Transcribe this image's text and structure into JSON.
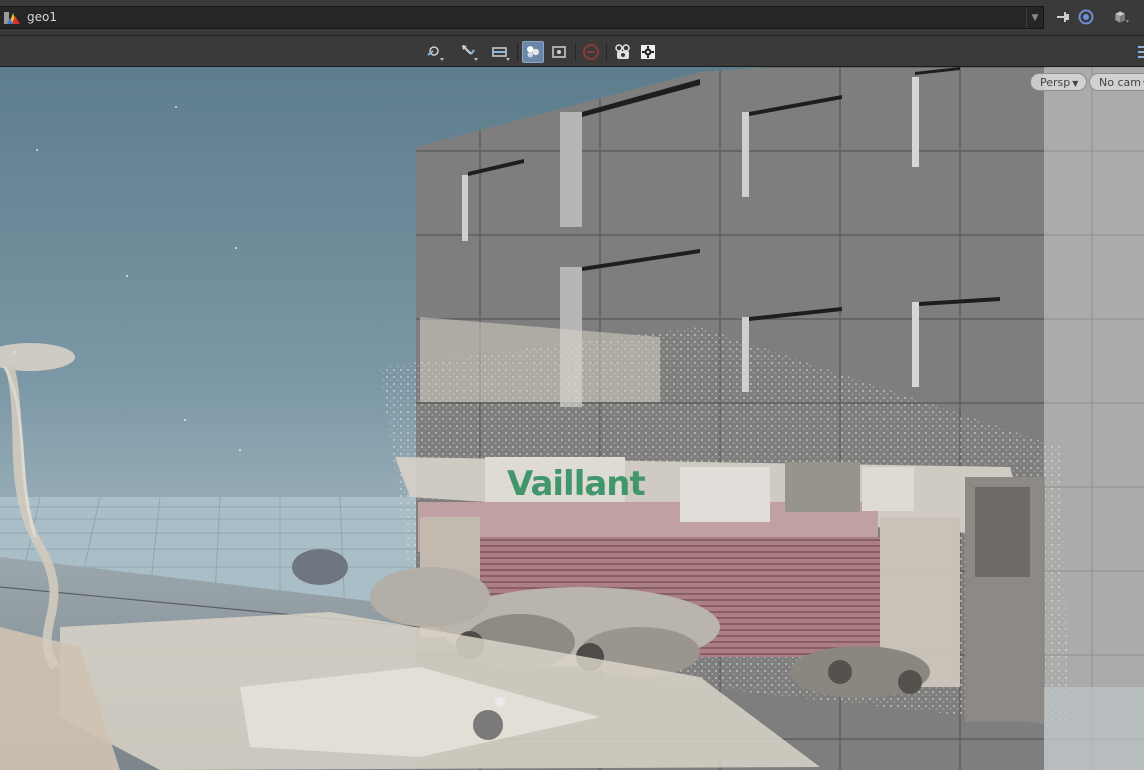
{
  "path_bar": {
    "network_path": "geo1",
    "icons": [
      "houdini-logo-icon",
      "pin-icon",
      "link-target-icon",
      "viewport-cube-icon"
    ]
  },
  "toolbar": {
    "icons": [
      "select-mode-icon",
      "transform-handle-icon",
      "snapping-icon",
      "ghost-objects-icon",
      "display-background-icon",
      "stop-icon",
      "camera-lock-icon",
      "gear-icon"
    ]
  },
  "viewport": {
    "view_menu_label": "Persp",
    "camera_menu_label": "No cam",
    "sign_text": "Vaillant"
  },
  "colors": {
    "accent": "#6a87a8",
    "panel": "#3a3a3a",
    "sky_top": "#5d7c8c",
    "sky_horizon": "#b4c1c6",
    "building_grey": "#7f7f7f"
  }
}
